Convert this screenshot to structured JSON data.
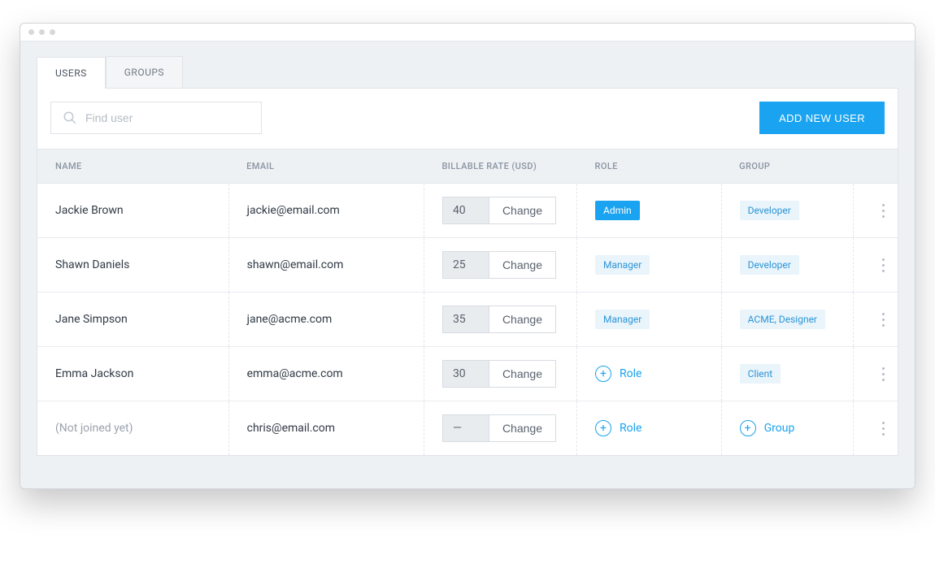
{
  "tabs": {
    "users": "USERS",
    "groups": "GROUPS"
  },
  "search": {
    "placeholder": "Find user"
  },
  "buttons": {
    "add_user": "ADD NEW USER"
  },
  "columns": {
    "name": "NAME",
    "email": "EMAIL",
    "rate": "BILLABLE RATE (USD)",
    "role": "ROLE",
    "group": "GROUP"
  },
  "labels": {
    "change": "Change",
    "role": "Role",
    "group": "Group",
    "empty_rate": "—"
  },
  "rows": [
    {
      "name": "Jackie Brown",
      "email": "jackie@email.com",
      "rate": "40",
      "role": {
        "type": "badge",
        "style": "admin",
        "text": "Admin"
      },
      "group": {
        "type": "badge",
        "text": "Developer"
      }
    },
    {
      "name": "Shawn Daniels",
      "email": "shawn@email.com",
      "rate": "25",
      "role": {
        "type": "badge",
        "text": "Manager"
      },
      "group": {
        "type": "badge",
        "text": "Developer"
      }
    },
    {
      "name": "Jane Simpson",
      "email": "jane@acme.com",
      "rate": "35",
      "role": {
        "type": "badge",
        "text": "Manager"
      },
      "group": {
        "type": "badge",
        "text": "ACME, Designer"
      }
    },
    {
      "name": "Emma Jackson",
      "email": "emma@acme.com",
      "rate": "30",
      "role": {
        "type": "add"
      },
      "group": {
        "type": "badge",
        "text": "Client"
      }
    },
    {
      "name": "(Not joined yet)",
      "name_muted": true,
      "email": "chris@email.com",
      "rate": null,
      "role": {
        "type": "add"
      },
      "group": {
        "type": "add"
      }
    }
  ]
}
